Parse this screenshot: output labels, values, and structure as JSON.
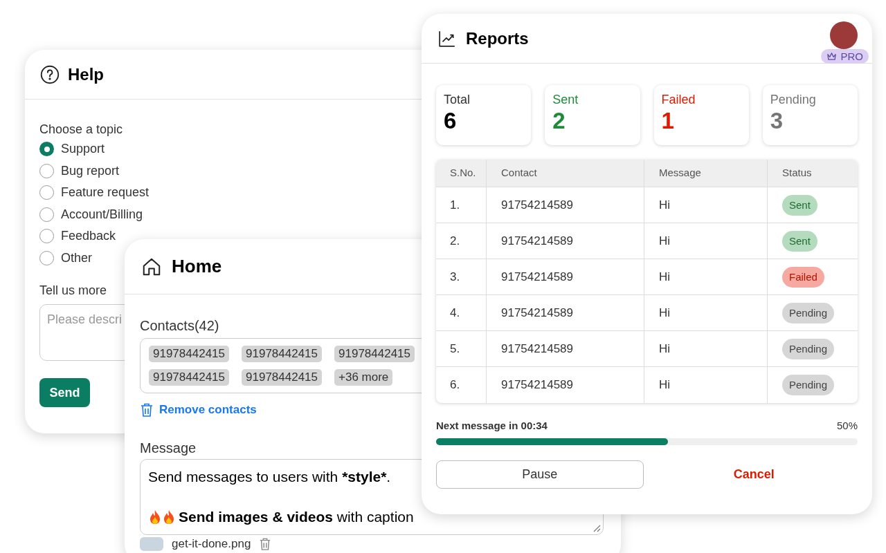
{
  "help": {
    "title": "Help",
    "topic_label": "Choose a topic",
    "topics": [
      {
        "label": "Support",
        "selected": true
      },
      {
        "label": "Bug report",
        "selected": false
      },
      {
        "label": "Feature request",
        "selected": false
      },
      {
        "label": "Account/Billing",
        "selected": false
      },
      {
        "label": "Feedback",
        "selected": false
      },
      {
        "label": "Other",
        "selected": false
      }
    ],
    "more_label": "Tell us more",
    "more_field": {
      "placeholder": "Please descri"
    },
    "send_button": "Send"
  },
  "home": {
    "title": "Home",
    "contacts_label": "Contacts(42)",
    "contacts": [
      "91978442415",
      "91978442415",
      "91978442415",
      "91978442415",
      "91978442415",
      "+36 more"
    ],
    "remove_link": "Remove contacts",
    "message_label": "Message",
    "message_lines": [
      {
        "fire_icons": false,
        "parts": [
          {
            "text": "Send messages to users with ",
            "bold": false
          },
          {
            "text": "*style*",
            "bold": true
          },
          {
            "text": ".",
            "bold": false
          }
        ]
      },
      {
        "fire_icons": true,
        "parts": [
          {
            "text": "Send images & videos",
            "bold": true
          },
          {
            "text": " with caption",
            "bold": false
          }
        ]
      }
    ],
    "attachment": "get-it-done.png"
  },
  "reports": {
    "title": "Reports",
    "badge": "PRO",
    "stats": [
      {
        "label": "Total",
        "value": "6",
        "kind": "total"
      },
      {
        "label": "Sent",
        "value": "2",
        "kind": "sent"
      },
      {
        "label": "Failed",
        "value": "1",
        "kind": "failed"
      },
      {
        "label": "Pending",
        "value": "3",
        "kind": "pending"
      }
    ],
    "table": {
      "columns": [
        "S.No.",
        "Contact",
        "Message",
        "Status"
      ],
      "rows": [
        {
          "sno": "1.",
          "contact": "91754214589",
          "message": "Hi",
          "status": "Sent",
          "kind": "sent"
        },
        {
          "sno": "2.",
          "contact": "91754214589",
          "message": "Hi",
          "status": "Sent",
          "kind": "sent"
        },
        {
          "sno": "3.",
          "contact": "91754214589",
          "message": "Hi",
          "status": "Failed",
          "kind": "failed"
        },
        {
          "sno": "4.",
          "contact": "91754214589",
          "message": "Hi",
          "status": "Pending",
          "kind": "pending"
        },
        {
          "sno": "5.",
          "contact": "91754214589",
          "message": "Hi",
          "status": "Pending",
          "kind": "pending"
        },
        {
          "sno": "6.",
          "contact": "91754214589",
          "message": "Hi",
          "status": "Pending",
          "kind": "pending"
        }
      ]
    },
    "progress": {
      "label": "Next message in 00:34",
      "reading": "50%",
      "level": 0.55
    },
    "pause_button": "Pause",
    "cancel_button": "Cancel"
  }
}
